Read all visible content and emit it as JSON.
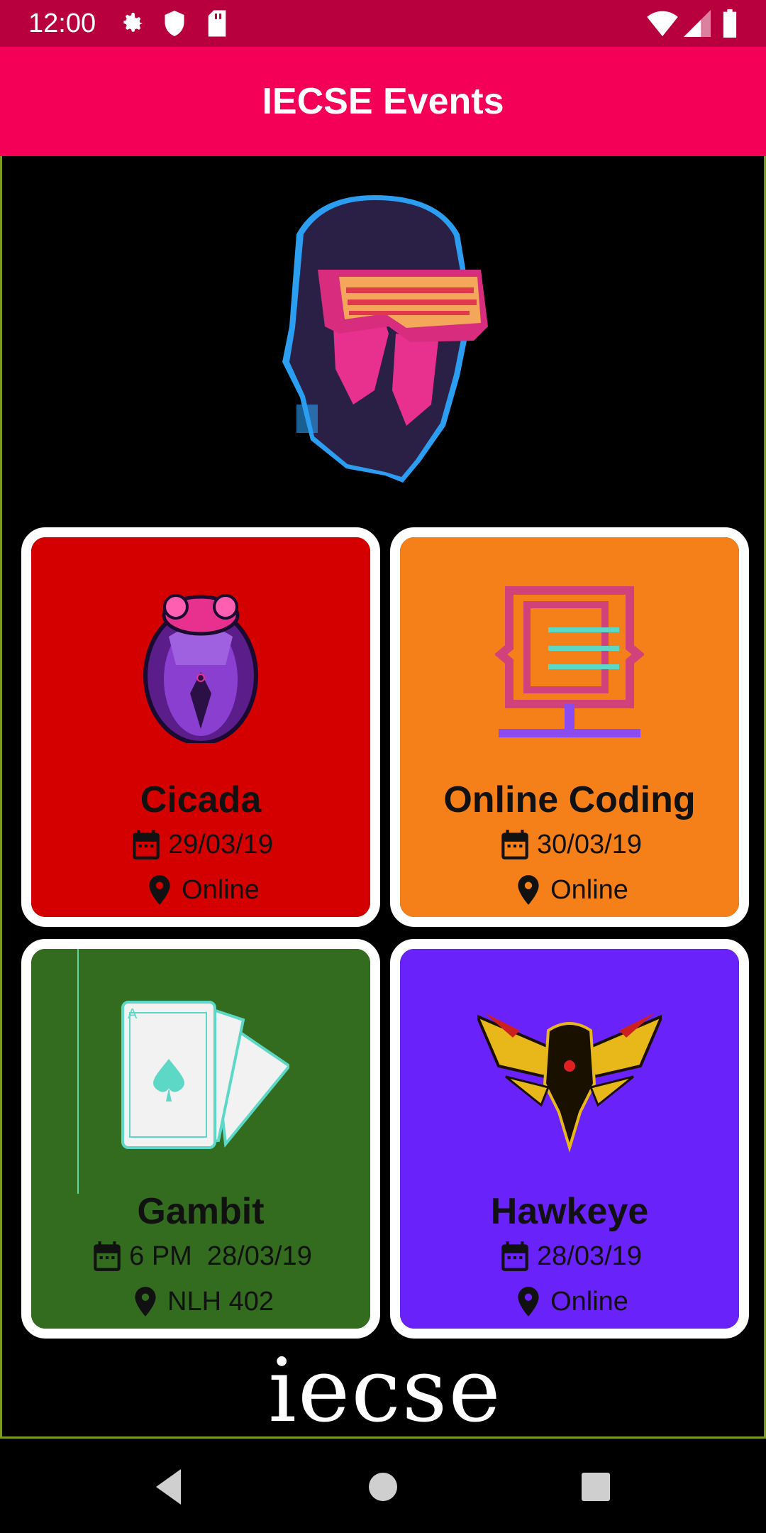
{
  "status_bar": {
    "time": "12:00",
    "icons_left": [
      "settings-icon",
      "shield-icon",
      "sd-card-icon"
    ],
    "icons_right": [
      "wifi-icon",
      "cell-signal-icon",
      "battery-icon"
    ]
  },
  "app_bar": {
    "title": "IECSE Events",
    "color": "#f50057"
  },
  "events": [
    {
      "name": "Cicada",
      "date": "29/03/19",
      "location": "Online",
      "color": "#d40000",
      "art": "cicada-icon"
    },
    {
      "name": "Online Coding",
      "date": "30/03/19",
      "location": "Online",
      "color": "#f5801a",
      "art": "coding-monitor-icon"
    },
    {
      "name": "Gambit",
      "date": "6 PM  28/03/19",
      "location": "NLH 402",
      "color": "#336b1f",
      "art": "playing-cards-icon"
    },
    {
      "name": "Hawkeye",
      "date": "28/03/19",
      "location": "Online",
      "color": "#6a22fb",
      "art": "eagle-icon"
    }
  ],
  "footer": {
    "logo_text": "iecse"
  },
  "nav": [
    "back",
    "home",
    "recents"
  ]
}
